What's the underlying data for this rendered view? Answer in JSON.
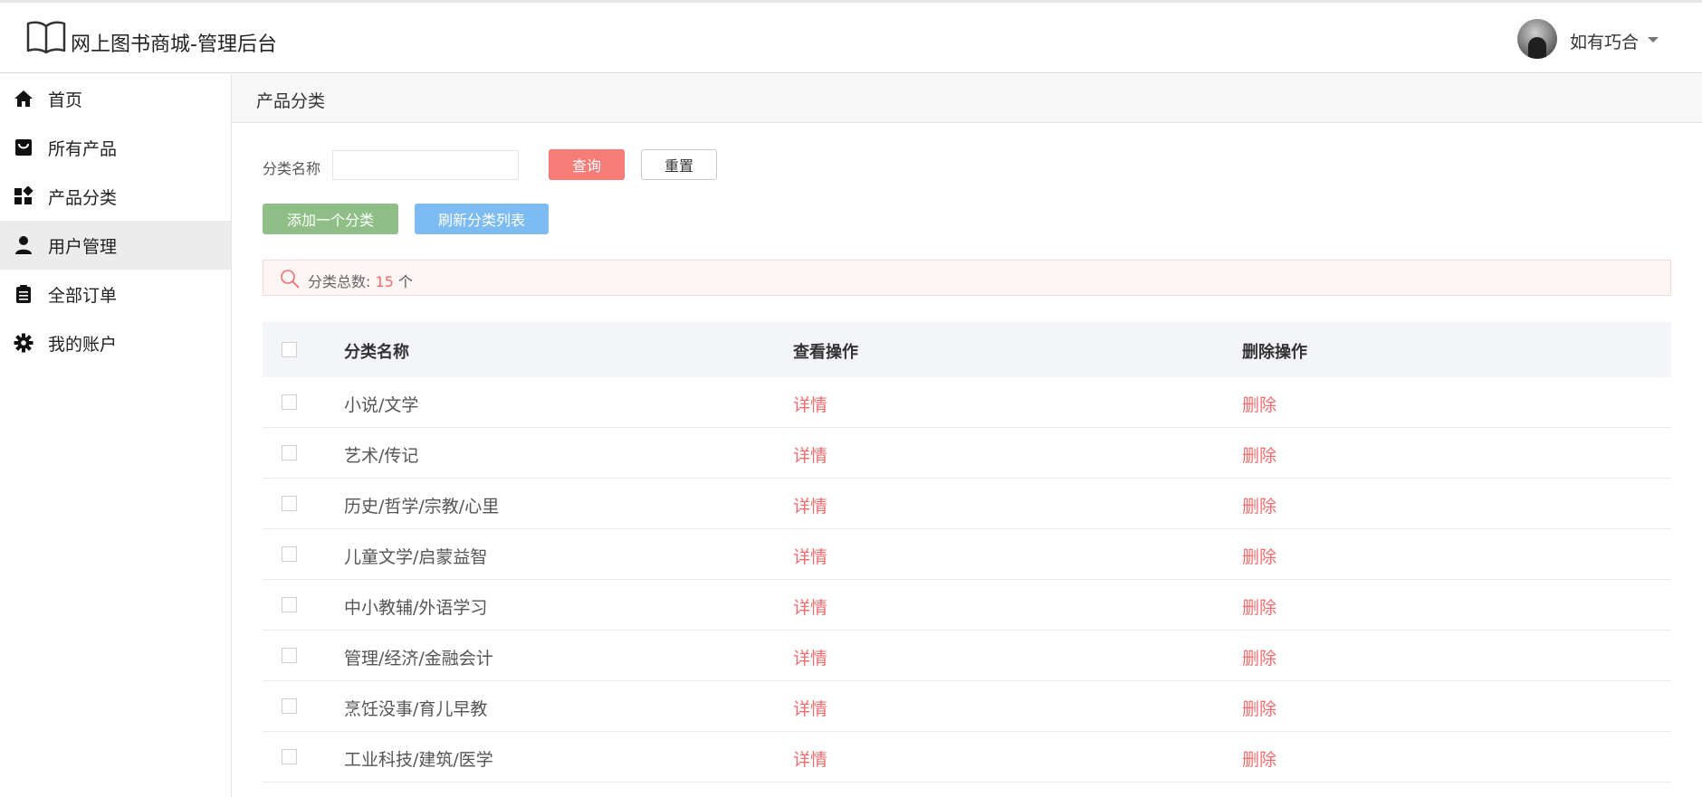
{
  "header": {
    "app_title": "网上图书商城-管理后台",
    "user_name": "如有巧合",
    "logo_icon": "open-book-icon",
    "caret_icon": "caret-down-icon"
  },
  "sidebar": {
    "items": [
      {
        "label": "首页",
        "icon": "home-icon"
      },
      {
        "label": "所有产品",
        "icon": "shopping-bag-icon"
      },
      {
        "label": "产品分类",
        "icon": "widgets-icon"
      },
      {
        "label": "用户管理",
        "icon": "user-icon",
        "active": true
      },
      {
        "label": "全部订单",
        "icon": "clipboard-icon"
      },
      {
        "label": "我的账户",
        "icon": "gear-icon"
      }
    ]
  },
  "breadcrumb": {
    "current": "产品分类"
  },
  "filter": {
    "label": "分类名称",
    "value": "",
    "query_label": "查询",
    "reset_label": "重置"
  },
  "actions": {
    "add_label": "添加一个分类",
    "refresh_label": "刷新分类列表"
  },
  "summary": {
    "label": "分类总数: ",
    "count": "15",
    "unit": " 个"
  },
  "table": {
    "columns": [
      "分类名称",
      "查看操作",
      "删除操作"
    ],
    "rows": [
      {
        "name": "小说/文学",
        "detail": "详情",
        "delete": "删除"
      },
      {
        "name": "艺术/传记",
        "detail": "详情",
        "delete": "删除"
      },
      {
        "name": "历史/哲学/宗教/心里",
        "detail": "详情",
        "delete": "删除"
      },
      {
        "name": "儿童文学/启蒙益智",
        "detail": "详情",
        "delete": "删除"
      },
      {
        "name": "中小教辅/外语学习",
        "detail": "详情",
        "delete": "删除"
      },
      {
        "name": "管理/经济/金融会计",
        "detail": "详情",
        "delete": "删除"
      },
      {
        "name": "烹饪没事/育儿早教",
        "detail": "详情",
        "delete": "删除"
      },
      {
        "name": "工业科技/建筑/医学",
        "detail": "详情",
        "delete": "删除"
      }
    ]
  },
  "colors": {
    "accent_red": "#f77b77",
    "link_red": "#f26d6d",
    "add_green": "#8fbf86",
    "refresh_blue": "#7cbcf2",
    "sidebar_active": "#ececec"
  }
}
